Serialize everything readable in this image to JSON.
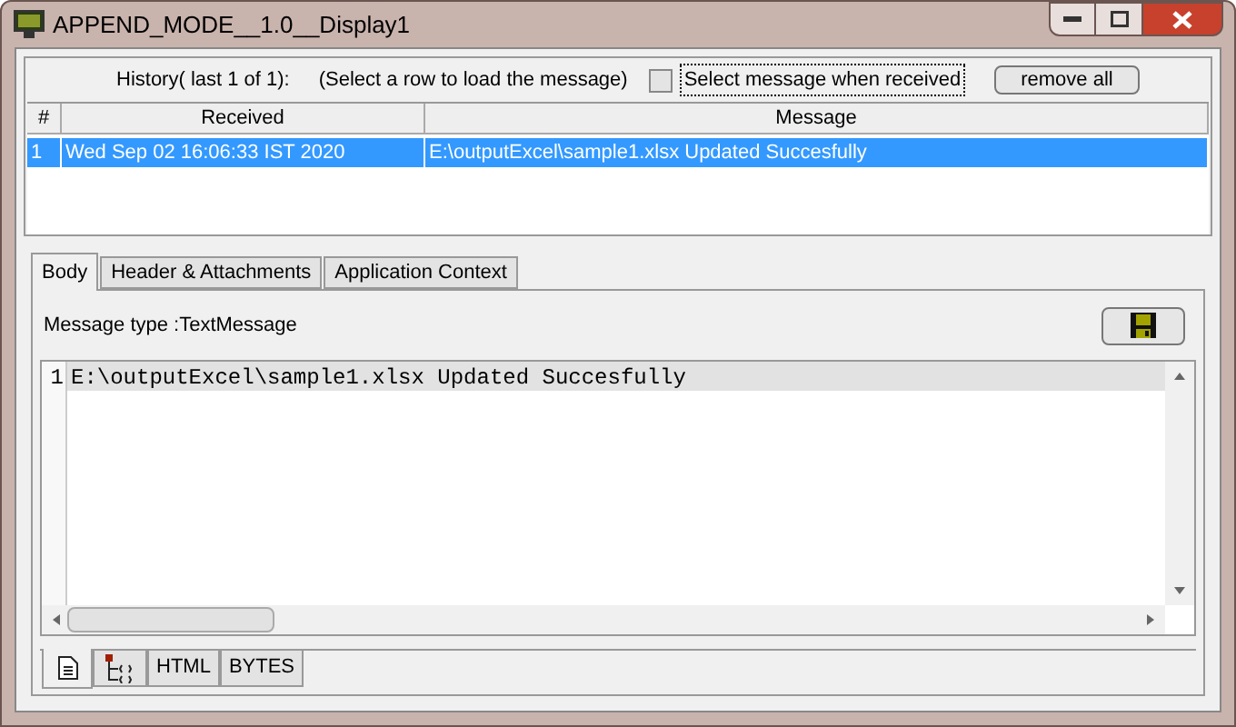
{
  "window": {
    "title": "APPEND_MODE__1.0__Display1"
  },
  "history": {
    "label": "History( last 1 of 1):",
    "hint": "(Select a row to load the message)",
    "select_on_receive": {
      "label": "Select message when received",
      "checked": false
    },
    "remove_button": "remove all"
  },
  "table": {
    "columns": [
      "#",
      "Received",
      "Message"
    ],
    "rows": [
      {
        "cells": [
          "1",
          "Wed Sep 02 16:06:33 IST 2020",
          "E:\\outputExcel\\sample1.xlsx Updated Succesfully"
        ],
        "selected": true
      }
    ]
  },
  "tabs": [
    {
      "label": "Body",
      "selected": true
    },
    {
      "label": "Header & Attachments",
      "selected": false
    },
    {
      "label": "Application Context",
      "selected": false
    }
  ],
  "message_type": "Message type :TextMessage",
  "editor": {
    "lines": [
      {
        "number": "1",
        "text": "E:\\outputExcel\\sample1.xlsx Updated Succesfully",
        "current": true
      }
    ]
  },
  "view_tabs": [
    {
      "kind": "document",
      "selected": true
    },
    {
      "kind": "tree",
      "selected": false
    },
    {
      "kind": "text",
      "label": "HTML",
      "selected": false
    },
    {
      "kind": "text",
      "label": "BYTES",
      "selected": false
    }
  ]
}
